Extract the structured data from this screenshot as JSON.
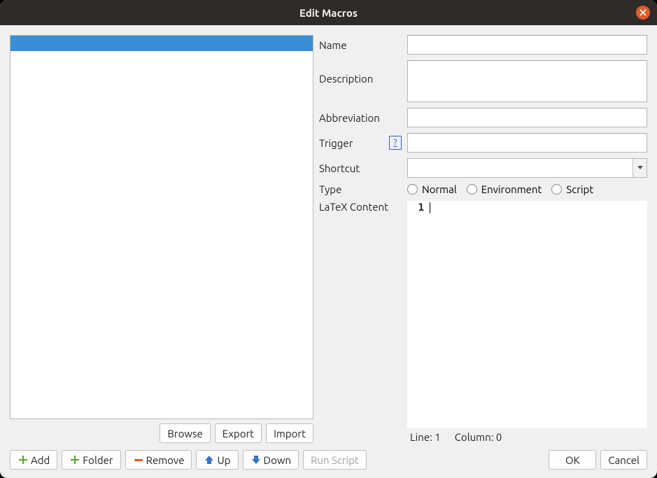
{
  "window": {
    "title": "Edit Macros"
  },
  "list": {
    "selected_index": 0
  },
  "left_buttons": {
    "browse": "Browse",
    "export": "Export",
    "import": "Import"
  },
  "form": {
    "name_label": "Name",
    "name_value": "",
    "description_label": "Description",
    "description_value": "",
    "abbreviation_label": "Abbreviation",
    "abbreviation_value": "",
    "trigger_label": "Trigger",
    "trigger_help": "?",
    "trigger_value": "",
    "shortcut_label": "Shortcut",
    "shortcut_value": "",
    "type_label": "Type",
    "type_options": {
      "normal": "Normal",
      "environment": "Environment",
      "script": "Script"
    },
    "latex_label": "LaTeX Content",
    "latex_line_number": "1",
    "latex_content": ""
  },
  "status": {
    "line_label": "Line:",
    "line_value": "1",
    "col_label": "Column:",
    "col_value": "0"
  },
  "bottom": {
    "add": "Add",
    "folder": "Folder",
    "remove": "Remove",
    "up": "Up",
    "down": "Down",
    "run_script": "Run Script",
    "ok": "OK",
    "cancel": "Cancel"
  }
}
